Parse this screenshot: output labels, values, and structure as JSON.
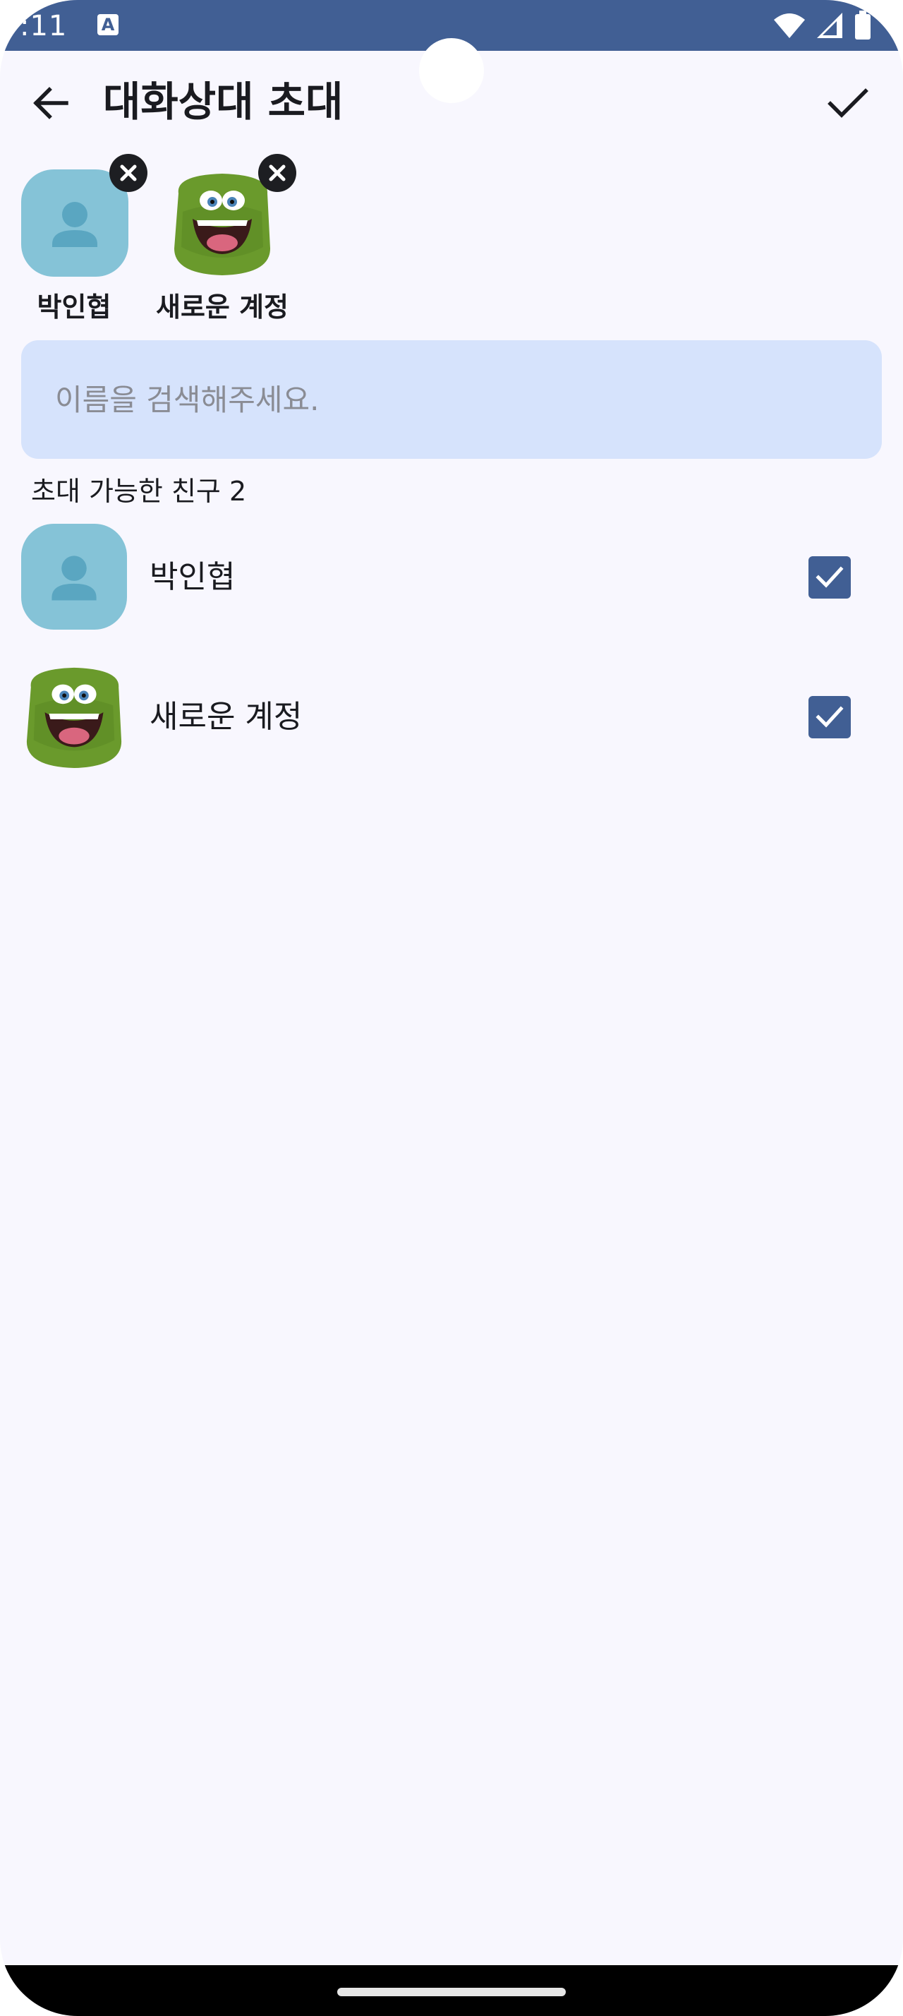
{
  "status_bar": {
    "time": ":11",
    "notification_icon": "a-icon",
    "icons": [
      "wifi-icon",
      "signal-icon",
      "battery-icon"
    ]
  },
  "app_bar": {
    "back_icon": "arrow-back-icon",
    "title": "대화상대 초대",
    "confirm_icon": "check-icon"
  },
  "selected": [
    {
      "name": "박인협",
      "avatar": "person-placeholder",
      "remove_icon": "close-icon"
    },
    {
      "name": "새로운 계정",
      "avatar": "green-monster-avatar",
      "remove_icon": "close-icon"
    }
  ],
  "search": {
    "placeholder": "이름을 검색해주세요.",
    "value": ""
  },
  "section_label": "초대 가능한 친구 2",
  "friends": [
    {
      "name": "박인협",
      "avatar": "person-placeholder",
      "checked": true
    },
    {
      "name": "새로운 계정",
      "avatar": "green-monster-avatar",
      "checked": true
    }
  ],
  "colors": {
    "primary": "#415f94",
    "background": "#f8f7fe",
    "search_bg": "#d6e3fc",
    "avatar_placeholder": "#85c3d7",
    "avatar_icon": "#5aa6c1"
  }
}
